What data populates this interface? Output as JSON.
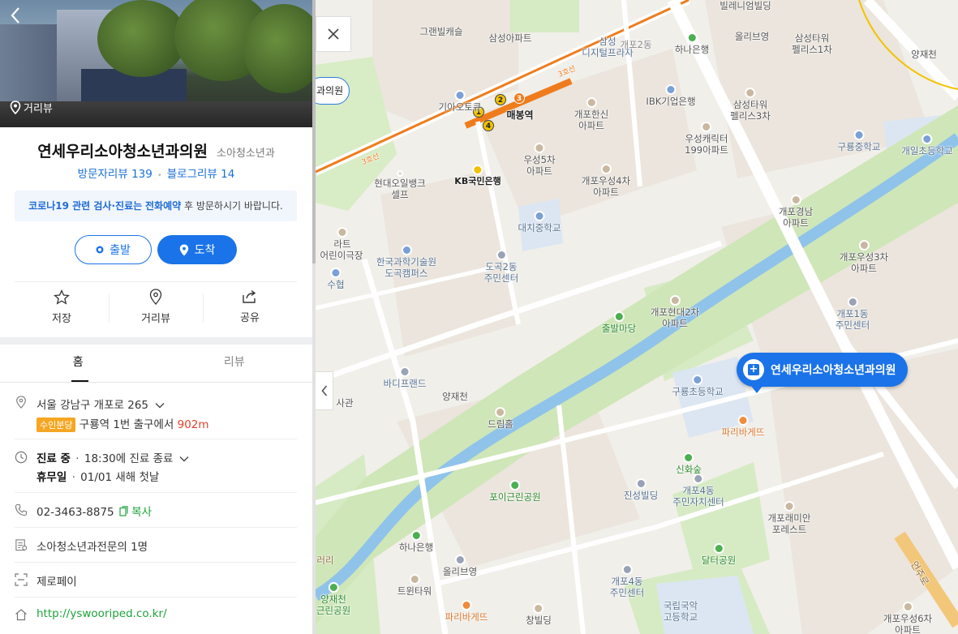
{
  "place": {
    "photo_label": "거리뷰",
    "name": "연세우리소아청소년과의원",
    "category": "소아청소년과",
    "visitor_review_label": "방문자리뷰 139",
    "blog_review_label": "블로그리뷰 14",
    "notice_pre": "코로나19 관련 검사·진료",
    "notice_mid1": "는",
    "notice_em": "전화예약",
    "notice_post": " 후 방문하시기 바랍니다."
  },
  "buttons": {
    "start": "출발",
    "arrive": "도착"
  },
  "actions": [
    {
      "label": "저장",
      "icon": "star-icon"
    },
    {
      "label": "거리뷰",
      "icon": "pin-icon"
    },
    {
      "label": "공유",
      "icon": "share-icon"
    }
  ],
  "tabs": [
    "홈",
    "리뷰"
  ],
  "info": {
    "address": "서울 강남구 개포로 265",
    "exit_badge": "수인분당",
    "exit_text": "구룡역 1번 출구에서",
    "exit_distance": "902m",
    "status": "진료 중",
    "status_detail": "18:30에 진료 종료",
    "holiday": "휴무일",
    "holiday_detail": "01/01 새해 첫날",
    "phone": "02-3463-8875",
    "copy_label": "복사",
    "specialist": "소아청소년과전문의 1명",
    "payment": "제로페이",
    "website": "http://yswooriped.co.kr/"
  },
  "map": {
    "route_pill": "과의원",
    "marker_label": "연세우리소아청소년과의원",
    "station_label": "매봉역",
    "line_label_a": "3호선",
    "line_label_b": "3호선",
    "labels": {
      "l1": "그랜빌캐슬",
      "l2": "삼성아파트",
      "l3": "삼성\n디지털프라자",
      "l4": "개포2동",
      "l5": "하나은행",
      "l6": "올리브영",
      "l7": "삼성타워\n펠리스1차",
      "l8": "빌레니엄빌딩",
      "l9": "양재천",
      "l10": "기아오토큐",
      "l11": "개포한신\n아파트",
      "l12": "IBK기업은행",
      "l13": "삼성타워\n펠리스3차",
      "l14": "우성캐릭터\n199아파트",
      "l15": "구룡중학교",
      "l16": "개일초등학교",
      "l17": "우성5차\n아파트",
      "l18": "KB국민은행",
      "l19": "현대오일뱅크\n셀프",
      "l20": "개포우성4차\n아파트",
      "l21": "대치중학교",
      "l22": "개포경남\n아파트",
      "l23": "라트",
      "l24": "어린이극장",
      "l25": "한국과학기술원\n도곡캠퍼스",
      "l26": "도곡2동\n주민센터",
      "l27": "개포우성3차\n아파트",
      "l28": "수협",
      "l29": "개포현대2차\n아파트",
      "l30": "출발마당",
      "l31": "개포1동\n주민센터",
      "l32": "바디프랜드",
      "l33": "양재천",
      "l34": "구룡초등학교",
      "l35": "파리바게뜨",
      "l36": "드림홀",
      "l37": "신화숲",
      "l38": "포이근린공원",
      "l39": "진성빌딩",
      "l40": "개포4동\n주민자치센터",
      "l41": "개포래미안\n포레스트",
      "l42": "하나은행",
      "l43": "달터공원",
      "l44": "올리브영",
      "l45": "트윈타워",
      "l46": "개포4동\n주민센터",
      "l47": "양재천\n근린공원",
      "l48": "파리바게뜨",
      "l49": "창빌딩",
      "l50": "개포우성6차\n아파트",
      "l51": "국립국악\n고등학교",
      "l52": "언주로",
      "l53": "사관",
      "l54": "러리"
    }
  },
  "colors": {
    "accent": "#1a73e8",
    "subway_line3": "#ef7c1c",
    "park": "#cfe6b8",
    "river": "#8fc3ea"
  }
}
